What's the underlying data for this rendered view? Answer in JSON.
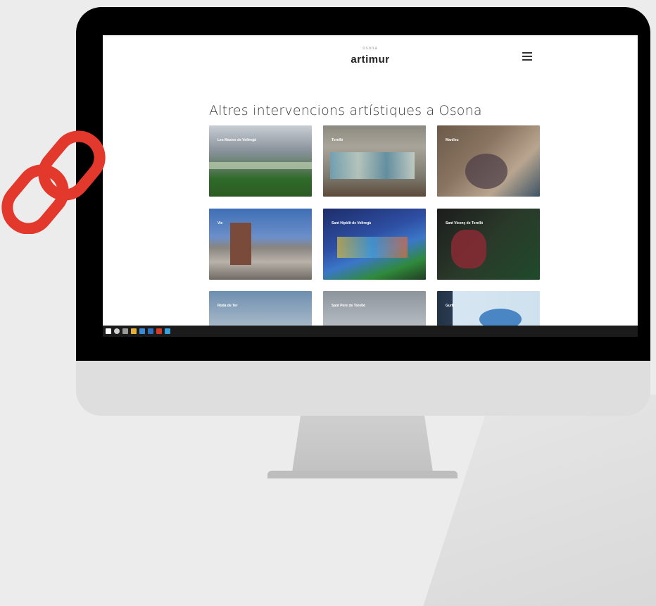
{
  "site": {
    "logo_small": "osona",
    "logo": "artimur",
    "section_title": "Altres intervencions artístiques a Osona"
  },
  "cards": [
    {
      "label": "Les Masies de Voltregà"
    },
    {
      "label": "Torelló"
    },
    {
      "label": "Manlleu"
    },
    {
      "label": "Vic"
    },
    {
      "label": "Sant Hipòlit de Voltregà"
    },
    {
      "label": "Sant Vicenç de Torelló"
    },
    {
      "label": "Roda de Ter"
    },
    {
      "label": "Sant Pere de Torelló"
    },
    {
      "label": "Gurb"
    }
  ],
  "icons": {
    "link": "chain-link-icon",
    "menu": "hamburger-menu-icon"
  },
  "colors": {
    "link_icon": "#e3382c",
    "bezel": "#000000",
    "chin": "#dedede",
    "taskbar": "#1b1b1b"
  }
}
